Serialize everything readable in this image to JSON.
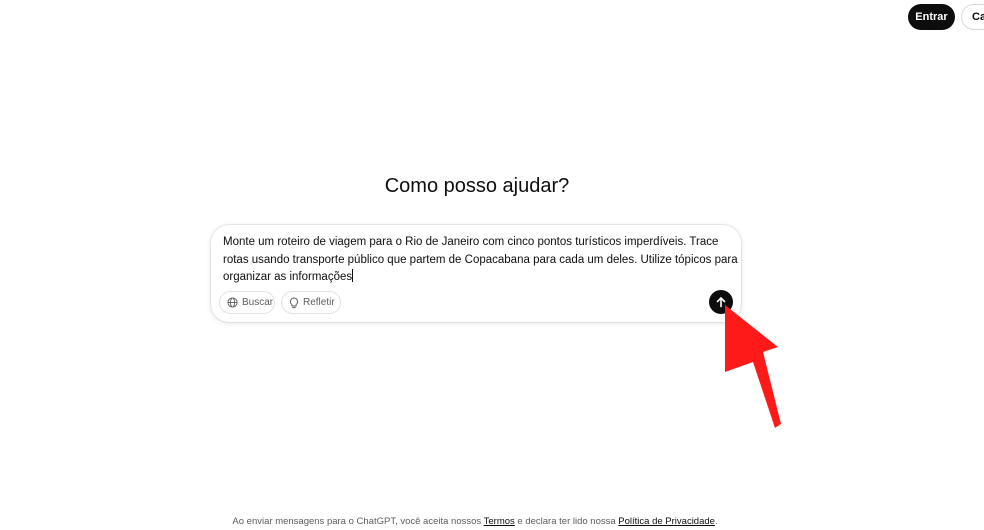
{
  "header": {
    "login_label": "Entrar",
    "signup_label": "Cadastrar"
  },
  "main": {
    "heading": "Como posso ajudar?"
  },
  "composer": {
    "text": "Monte um roteiro de viagem para o Rio de Janeiro com cinco pontos turísticos imperdíveis. Trace rotas usando transporte público que partem de Copacabana para cada um deles. Utilize tópicos para organizar as informações",
    "tools": [
      {
        "label": "Buscar",
        "icon": "globe-icon"
      },
      {
        "label": "Refletir",
        "icon": "lightbulb-icon"
      }
    ],
    "send_icon": "arrow-up-icon"
  },
  "annotation": {
    "arrow_color": "#ff0000",
    "arrow_icon": "arrow-pointer-annotation"
  },
  "footer": {
    "prefix": "Ao enviar mensagens para o ChatGPT, você aceita nossos ",
    "terms_link": "Termos",
    "middle": " e declara ter lido nossa ",
    "privacy_link": "Política de Privacidade",
    "suffix": "."
  },
  "colors": {
    "primary_button": "#0d0d0d",
    "background": "#ffffff",
    "muted_text": "#5d5d5d"
  }
}
